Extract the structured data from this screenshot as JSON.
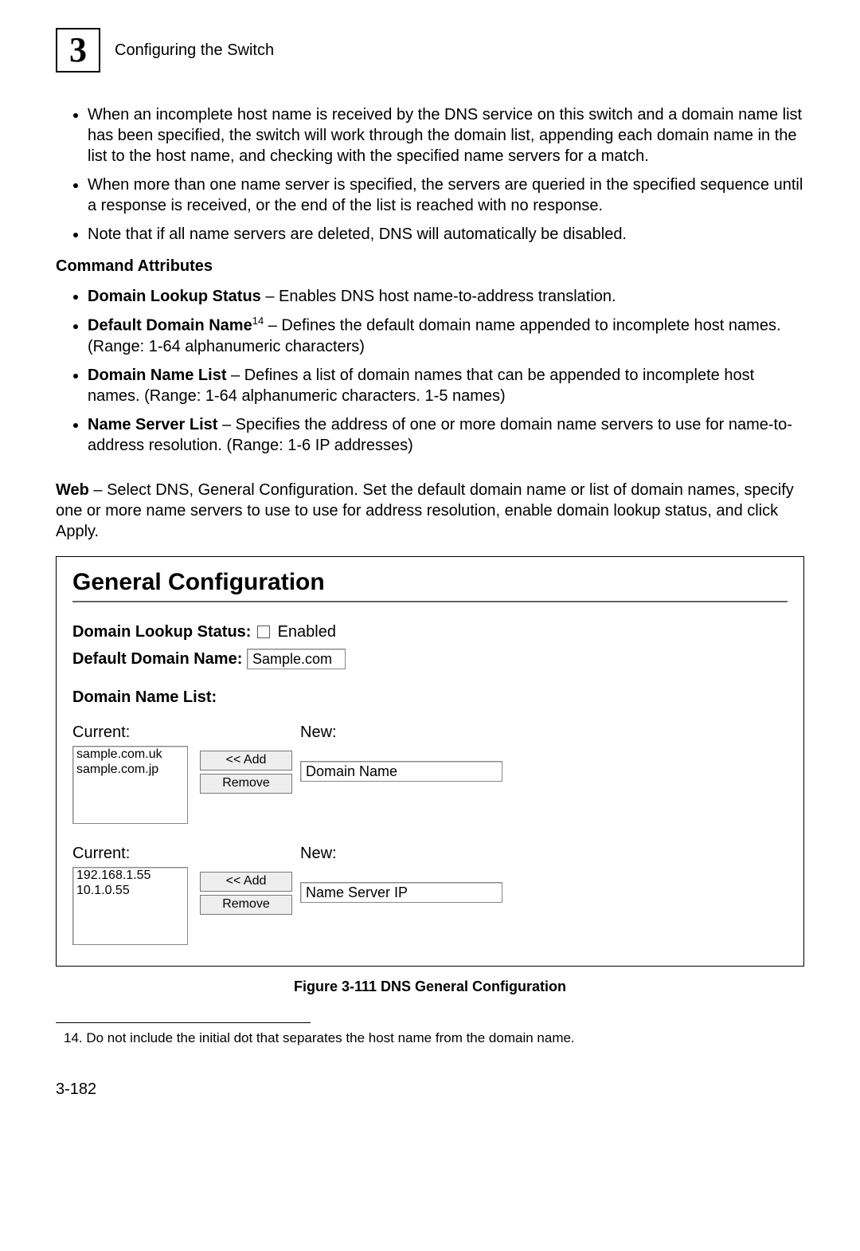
{
  "header": {
    "chapter_number": "3",
    "title": "Configuring the Switch"
  },
  "intro_bullets": [
    "When an incomplete host name is received by the DNS service on this switch and a domain name list has been specified, the switch will work through the domain list, appending each domain name in the list to the host name, and checking with the specified name servers for a match.",
    "When more than one name server is specified, the servers are queried in the specified sequence until a response is received, or the end of the list is reached with no response.",
    "Note that if all name servers are deleted, DNS will automatically be disabled."
  ],
  "cmd_attr_heading": "Command Attributes",
  "cmd_attrs": [
    {
      "label": "Domain Lookup Status",
      "desc": " – Enables DNS host name-to-address translation."
    },
    {
      "label": "Default Domain Name",
      "sup": "14",
      "desc": " – Defines the default domain name appended to incomplete host names. (Range: 1-64 alphanumeric characters)"
    },
    {
      "label": "Domain Name List",
      "desc": " – Defines a list of domain names that can be appended to incomplete host names. (Range: 1-64 alphanumeric characters. 1-5 names)"
    },
    {
      "label": "Name Server List",
      "desc": " – Specifies the address of one or more domain name servers to use for name-to-address resolution. (Range: 1-6 IP addresses)"
    }
  ],
  "web_label": "Web",
  "web_text": " – Select DNS, General Configuration. Set the default domain name or list of domain names, specify one or more name servers to use to use for address resolution, enable domain lookup status, and click Apply.",
  "panel": {
    "title": "General Configuration",
    "lookup_label": "Domain Lookup Status:",
    "lookup_value": "Enabled",
    "default_label": "Default Domain Name:",
    "default_value": "Sample.com",
    "dnl_heading": "Domain Name List:",
    "current_label": "Current:",
    "new_label": "New:",
    "domain_list": [
      "sample.com.uk",
      "sample.com.jp"
    ],
    "domain_placeholder": "Domain Name",
    "add_btn": "<< Add",
    "remove_btn": "Remove",
    "ns_list": [
      "192.168.1.55",
      "10.1.0.55"
    ],
    "ns_placeholder": "Name Server IP"
  },
  "figure_caption": "Figure 3-111  DNS General Configuration",
  "footnote": "14.  Do not include the initial dot that separates the host name from the domain name.",
  "page_number": "3-182"
}
